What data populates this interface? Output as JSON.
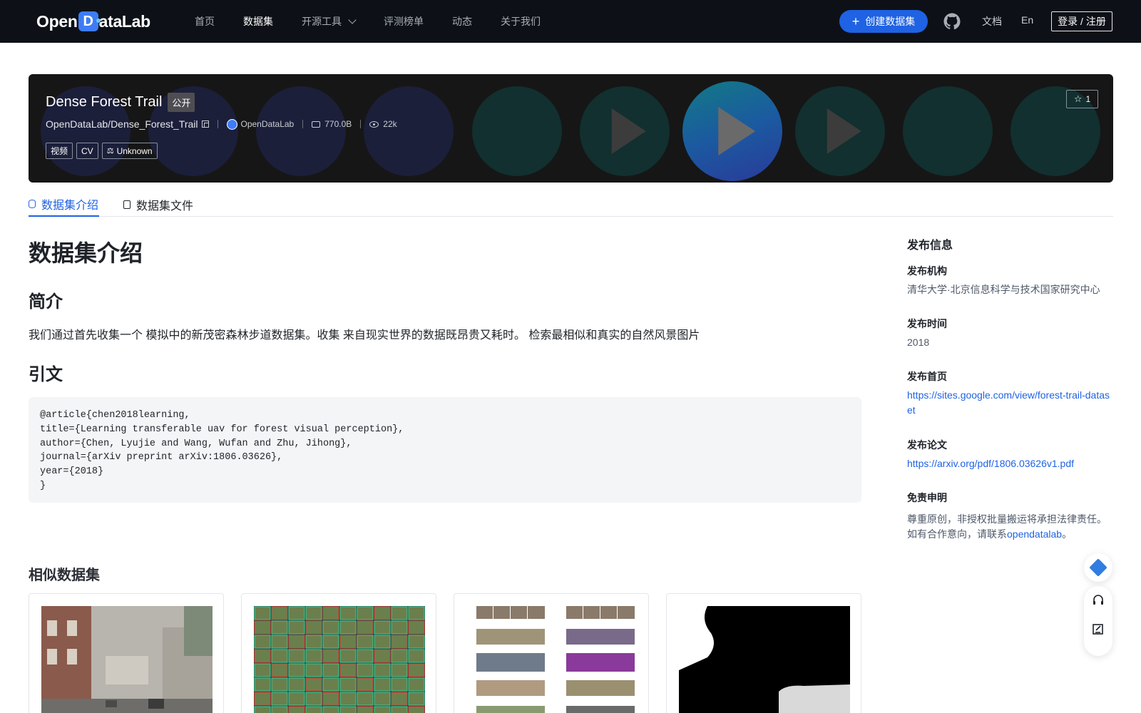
{
  "nav": {
    "logo_pre": "Open",
    "logo_mark": "D",
    "logo_post": "ataLab",
    "links": [
      "首页",
      "数据集",
      "开源工具",
      "评测榜单",
      "动态",
      "关于我们"
    ],
    "create_label": "创建数据集",
    "doc": "文档",
    "lang": "En",
    "login": "登录 / 注册"
  },
  "banner": {
    "title": "Dense Forest Trail",
    "visibility": "公开",
    "repo": "OpenDataLab/Dense_Forest_Trail",
    "org": "OpenDataLab",
    "size": "770.0B",
    "views": "22k",
    "tags": [
      "视频",
      "CV",
      "Unknown"
    ],
    "stars": "1"
  },
  "tabs": [
    "数据集介绍",
    "数据集文件"
  ],
  "main": {
    "heading": "数据集介绍",
    "intro_heading": "简介",
    "intro_text": "我们通过首先收集一个 模拟中的新茂密森林步道数据集。收集 来自现实世界的数据既昂贵又耗时。 检索最相似和真实的自然风景图片",
    "cite_heading": "引文",
    "citation": "@article{chen2018learning,\ntitle={Learning transferable uav for forest visual perception},\nauthor={Chen, Lyujie and Wang, Wufan and Zhu, Jihong},\njournal={arXiv preprint arXiv:1806.03626},\nyear={2018}\n}",
    "similar_heading": "相似数据集"
  },
  "side": {
    "title": "发布信息",
    "org_label": "发布机构",
    "org_value": "清华大学·北京信息科学与技术国家研究中心",
    "time_label": "发布时间",
    "time_value": "2018",
    "home_label": "发布首页",
    "home_value": "https://sites.google.com/view/forest-trail-dataset",
    "paper_label": "发布论文",
    "paper_value": "https://arxiv.org/pdf/1806.03626v1.pdf",
    "disclaimer_label": "免责申明",
    "disclaimer_text1": "尊重原创，非授权批量搬运将承担法律责任。",
    "disclaimer_text2_pre": "如有合作意向，请联系",
    "disclaimer_link": "opendatalab",
    "disclaimer_text2_post": "。"
  },
  "colors": {
    "nav_bg": "#0d1117",
    "accent": "#1f62e3",
    "banner_bg": "#161616"
  }
}
